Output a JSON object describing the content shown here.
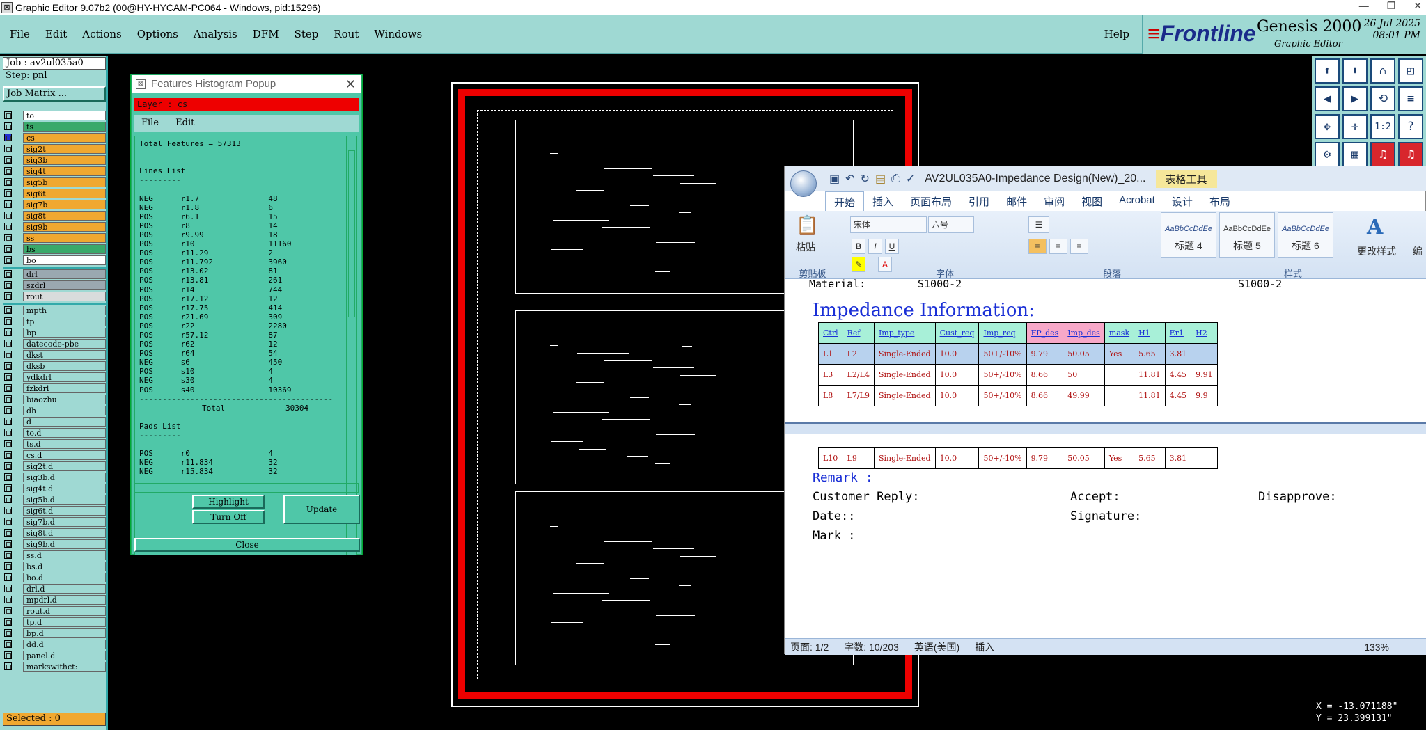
{
  "titlebar": {
    "title": "Graphic Editor 9.07b2 (00@HY-HYCAM-PC064 - Windows, pid:15296)",
    "min": "—",
    "max": "❐",
    "close": "✕"
  },
  "menubar": {
    "items": [
      "File",
      "Edit",
      "Actions",
      "Options",
      "Analysis",
      "DFM",
      "Step",
      "Rout",
      "Windows"
    ],
    "help": "Help"
  },
  "brand": {
    "logo_a": "≡",
    "logo_b": "Frontline",
    "product": "Genesis 2000",
    "subtitle": "Graphic Editor",
    "date": "26 Jul 2025",
    "time": "08:01 PM"
  },
  "left": {
    "job": "Job : av2ul035a0",
    "step": "Step: pnl",
    "matrix": "Job Matrix ...",
    "selected": "Selected : 0"
  },
  "layers_board": [
    {
      "name": "to",
      "bg": "#ffffff"
    },
    {
      "name": "ts",
      "bg": "#3aa96a"
    },
    {
      "name": "cs",
      "bg": "#f0a830"
    },
    {
      "name": "sig2t",
      "bg": "#f0a830"
    },
    {
      "name": "sig3b",
      "bg": "#f0a830"
    },
    {
      "name": "sig4t",
      "bg": "#f0a830"
    },
    {
      "name": "sig5b",
      "bg": "#f0a830"
    },
    {
      "name": "sig6t",
      "bg": "#f0a830"
    },
    {
      "name": "sig7b",
      "bg": "#f0a830"
    },
    {
      "name": "sig8t",
      "bg": "#f0a830"
    },
    {
      "name": "sig9b",
      "bg": "#f0a830"
    },
    {
      "name": "ss",
      "bg": "#f0a830"
    },
    {
      "name": "bs",
      "bg": "#3aa96a"
    },
    {
      "name": "bo",
      "bg": "#ffffff"
    }
  ],
  "layers_drill": [
    {
      "name": "drl",
      "bg": "#9aa8b0"
    },
    {
      "name": "szdrl",
      "bg": "#9aa8b0"
    },
    {
      "name": "rout",
      "bg": "#d8dcdc"
    }
  ],
  "layers_misc": [
    "mpth",
    "tp",
    "bp",
    "datecode-pbe",
    "dkst",
    "dksb",
    "ydkdrl",
    "fzkdrl",
    "biaozhu",
    "dh",
    "d",
    "to.d",
    "ts.d",
    "cs.d",
    "sig2t.d",
    "sig3b.d",
    "sig4t.d",
    "sig5b.d",
    "sig6t.d",
    "sig7b.d",
    "sig8t.d",
    "sig9b.d",
    "ss.d",
    "bs.d",
    "bo.d",
    "drl.d",
    "mpdrl.d",
    "rout.d",
    "tp.d",
    "bp.d",
    "dd.d",
    "panel.d",
    "markswithct:"
  ],
  "popup": {
    "title": "Features Histogram Popup",
    "close": "✕",
    "layer": "Layer :  cs",
    "menu": [
      "File",
      "Edit"
    ],
    "total": "Total Features = 57313",
    "lines_title": "Lines List",
    "sepline": "---------",
    "lines": [
      [
        "NEG",
        "r1.7",
        "48"
      ],
      [
        "NEG",
        "r1.8",
        "6"
      ],
      [
        "POS",
        "r6.1",
        "15"
      ],
      [
        "POS",
        "r8",
        "14"
      ],
      [
        "POS",
        "r9.99",
        "18"
      ],
      [
        "POS",
        "r10",
        "11160"
      ],
      [
        "POS",
        "r11.29",
        "2"
      ],
      [
        "POS",
        "r11.792",
        "3960"
      ],
      [
        "POS",
        "r13.02",
        "81"
      ],
      [
        "POS",
        "r13.81",
        "261"
      ],
      [
        "POS",
        "r14",
        "744"
      ],
      [
        "POS",
        "r17.12",
        "12"
      ],
      [
        "POS",
        "r17.75",
        "414"
      ],
      [
        "POS",
        "r21.69",
        "309"
      ],
      [
        "POS",
        "r22",
        "2280"
      ],
      [
        "POS",
        "r57.12",
        "87"
      ],
      [
        "POS",
        "r62",
        "12"
      ],
      [
        "POS",
        "r64",
        "54"
      ],
      [
        "NEG",
        "s6",
        "450"
      ],
      [
        "POS",
        "s10",
        "4"
      ],
      [
        "NEG",
        "s30",
        "4"
      ],
      [
        "POS",
        "s40",
        "10369"
      ]
    ],
    "divider": "------------------------------------------",
    "total_label": "Total",
    "total_value": "30304",
    "pads_title": "Pads List",
    "pads_sep": "---------",
    "pads": [
      [
        "POS",
        "r0",
        "4"
      ],
      [
        "NEG",
        "r11.834",
        "32"
      ],
      [
        "NEG",
        "r15.834",
        "32"
      ]
    ],
    "buttons": {
      "highlight": "Highlight",
      "turnoff": "Turn Off",
      "update": "Update",
      "close": "Close"
    }
  },
  "coords": {
    "x": "X = -13.071188\"",
    "y": "Y = 23.399131\""
  },
  "word": {
    "title": "AV2UL035A0-Impedance Design(New)_20...",
    "context_tab": "表格工具",
    "tabs": [
      "开始",
      "插入",
      "页面布局",
      "引用",
      "邮件",
      "审阅",
      "视图",
      "Acrobat",
      "设计",
      "布局"
    ],
    "font": "宋体",
    "size": "六号",
    "paste": "粘贴",
    "groups": [
      "剪贴板",
      "字体",
      "段落",
      "样式"
    ],
    "styles": [
      {
        "preview": "AaBbCcDdEe",
        "name": "标题 4"
      },
      {
        "preview": "AaBbCcDdEe",
        "name": "标题 5"
      },
      {
        "preview": "AaBbCcDdEe",
        "name": "标题 6"
      }
    ],
    "change_styles": "更改样式",
    "edit": "编",
    "material_label": "Material:",
    "material_v1": "S1000-2",
    "material_v2": "S1000-2",
    "heading": "Impedance Information:",
    "table_headers": [
      "Ctrl",
      "Ref",
      "Imp_type",
      "Cust_req",
      "Imp_req",
      "FP_des",
      "Imp_des",
      "mask",
      "H1",
      "Er1",
      "H2"
    ],
    "rows": [
      [
        "L1",
        "L2",
        "Single-Ended",
        "10.0",
        "50+/-10%",
        "9.79",
        "50.05",
        "Yes",
        "5.65",
        "3.81",
        ""
      ],
      [
        "L3",
        "L2/L4",
        "Single-Ended",
        "10.0",
        "50+/-10%",
        "8.66",
        "50",
        "",
        "11.81",
        "4.45",
        "9.91"
      ],
      [
        "L8",
        "L7/L9",
        "Single-Ended",
        "10.0",
        "50+/-10%",
        "8.66",
        "49.99",
        "",
        "11.81",
        "4.45",
        "9.9"
      ]
    ],
    "row_last": [
      "L10",
      "L9",
      "Single-Ended",
      "10.0",
      "50+/-10%",
      "9.79",
      "50.05",
      "Yes",
      "5.65",
      "3.81",
      ""
    ],
    "remark": "Remark :",
    "customer_reply": "Customer Reply:",
    "accept": "Accept:",
    "disapprove": "Disapprove:",
    "date": "Date::",
    "signature": "Signature:",
    "mark": "Mark :",
    "status": {
      "page": "页面: 1/2",
      "words": "字数: 10/203",
      "lang": "英语(美国)",
      "mode": "插入",
      "zoom": "133%"
    }
  }
}
